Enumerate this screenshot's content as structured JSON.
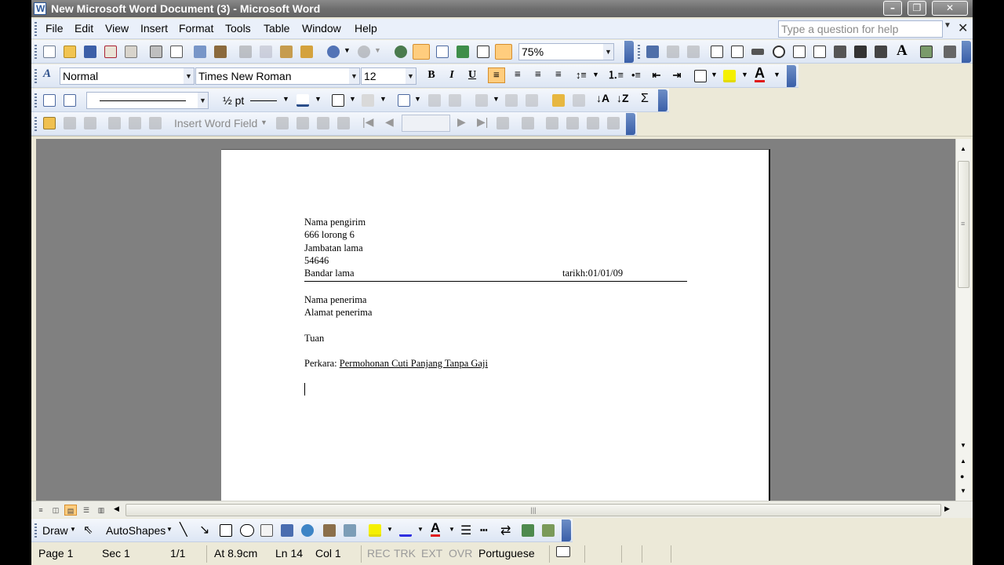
{
  "window": {
    "title": "New Microsoft Word Document (3) - Microsoft Word"
  },
  "menu": {
    "items": [
      "File",
      "Edit",
      "View",
      "Insert",
      "Format",
      "Tools",
      "Table",
      "Window",
      "Help"
    ],
    "ask_placeholder": "Type a question for help"
  },
  "standard_toolbar": {
    "zoom": "75%"
  },
  "formatting_toolbar": {
    "style": "Normal",
    "font": "Times New Roman",
    "size": "12"
  },
  "tables_toolbar": {
    "line_weight": "½ pt"
  },
  "mail_merge_toolbar": {
    "insert_word_field": "Insert Word Field"
  },
  "document": {
    "sender_lines": [
      "Nama pengirim",
      "666 lorong 6",
      "Jambatan lama",
      "54646",
      "Bandar lama"
    ],
    "date": "tarikh:01/01/09",
    "recipient_lines": [
      "Nama penerima",
      "Alamat penerima"
    ],
    "salutation": "Tuan",
    "subject_prefix": "Perkara: ",
    "subject": "Permohonan Cuti Panjang Tanpa Gaji"
  },
  "drawing_toolbar": {
    "draw": "Draw",
    "autoshapes": "AutoShapes"
  },
  "status_bar": {
    "page": "Page 1",
    "sec": "Sec 1",
    "pages": "1/1",
    "at": "At 8.9cm",
    "ln": "Ln 14",
    "col": "Col 1",
    "rec": "REC",
    "trk": "TRK",
    "ext": "EXT",
    "ovr": "OVR",
    "language": "Portuguese"
  },
  "colors": {
    "accent": "#FFCD7E",
    "toolbar": "#DDE6F4",
    "titlebar": "#6E6E6E",
    "workspace": "#808080"
  }
}
